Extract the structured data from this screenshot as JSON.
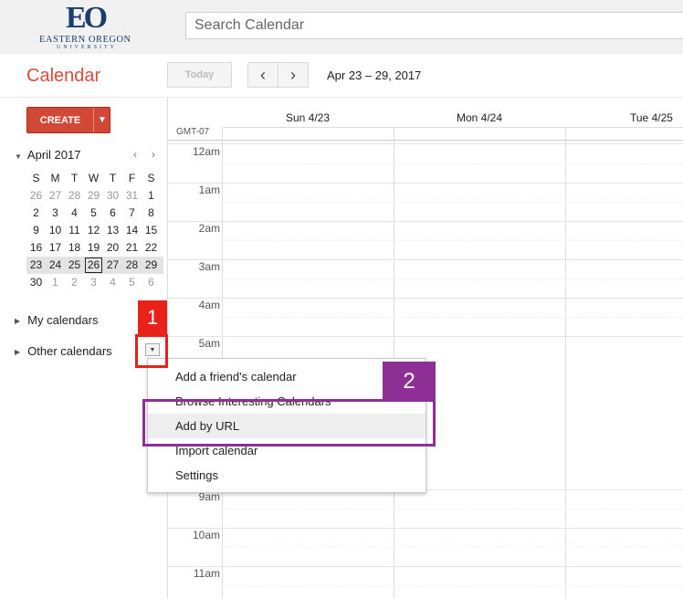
{
  "header": {
    "logo_mark": "EO",
    "logo_name": "EASTERN OREGON",
    "logo_sub": "UNIVERSITY",
    "search_placeholder": "Search Calendar",
    "app_title": "Calendar",
    "today_label": "Today",
    "prev_icon": "‹",
    "next_icon": "›",
    "date_range": "Apr 23 – 29, 2017"
  },
  "sidebar": {
    "create_label": "CREATE",
    "create_arrow": "▼",
    "mini_month": "April 2017",
    "mini_prev": "‹",
    "mini_next": "›",
    "weekdays": [
      "S",
      "M",
      "T",
      "W",
      "T",
      "F",
      "S"
    ],
    "weeks": [
      [
        "26",
        "27",
        "28",
        "29",
        "30",
        "31",
        "1"
      ],
      [
        "2",
        "3",
        "4",
        "5",
        "6",
        "7",
        "8"
      ],
      [
        "9",
        "10",
        "11",
        "12",
        "13",
        "14",
        "15"
      ],
      [
        "16",
        "17",
        "18",
        "19",
        "20",
        "21",
        "22"
      ],
      [
        "23",
        "24",
        "25",
        "26",
        "27",
        "28",
        "29"
      ],
      [
        "30",
        "1",
        "2",
        "3",
        "4",
        "5",
        "6"
      ]
    ],
    "my_calendars": "My calendars",
    "other_calendars": "Other calendars",
    "dropdown_icon": "▼"
  },
  "grid": {
    "timezone": "GMT-07",
    "days": [
      "Sun 4/23",
      "Mon 4/24",
      "Tue 4/25"
    ],
    "hours": [
      "12am",
      "1am",
      "2am",
      "3am",
      "4am",
      "5am",
      "9am",
      "10am",
      "11am"
    ]
  },
  "menu": {
    "items": [
      "Add a friend's calendar",
      "Browse Interesting Calendars",
      "Add by URL",
      "Import calendar",
      "Settings"
    ]
  },
  "annotations": {
    "step1": "1",
    "step2": "2",
    "step1_color": "#e8221b",
    "step2_color": "#8e2f96"
  },
  "colors": {
    "accent": "#dd4b39",
    "create_button": "#d14836"
  }
}
